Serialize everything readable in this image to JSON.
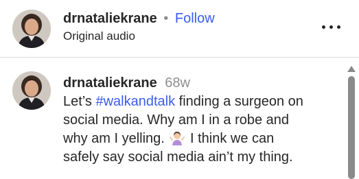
{
  "header": {
    "username": "drnataliekrane",
    "separator": "•",
    "follow_label": "Follow",
    "subtitle": "Original audio",
    "more_icon": "more-horizontal-icon"
  },
  "comment": {
    "username": "drnataliekrane",
    "timestamp": "68w",
    "line1_prefix": "Let’s ",
    "hashtag": "#walkandtalk",
    "line1_suffix": " finding a surgeon on",
    "line2": "social media. Why am I in a robe and",
    "line3_before_emoji": "why am I yelling.",
    "emoji_name": "woman-shrugging-emoji",
    "line3_after_emoji": " I think we can",
    "line4": "safely say social media ain’t my thing."
  },
  "colors": {
    "link_blue": "#3b5cf0",
    "text_dark": "#262626",
    "text_muted": "#8e8e8e",
    "divider": "#dbdbdb",
    "scrollbar": "#8a8a8a"
  }
}
